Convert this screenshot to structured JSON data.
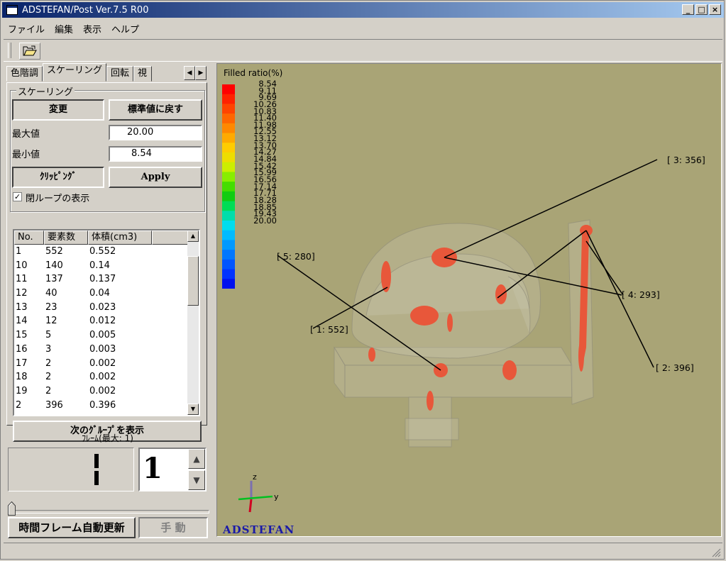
{
  "window": {
    "title": "ADSTEFAN/Post Ver.7.5 R00",
    "btn_min": "_",
    "btn_max": "□",
    "btn_close": "×"
  },
  "menu": [
    "ファイル",
    "編集",
    "表示",
    "ヘルプ"
  ],
  "tabs": [
    "色階調",
    "スケーリング",
    "回転",
    "視"
  ],
  "scaling": {
    "group_title": "スケーリング",
    "change_label": "変更",
    "reset_label": "標準値に戻す",
    "max_label": "最大値",
    "max_value": "20.00",
    "min_label": "最小値",
    "min_value": "8.54",
    "clipping_label": "ｸﾘｯﾋﾟﾝｸﾞ",
    "apply_label": "Apply",
    "closed_loop_label": "閉ループの表示",
    "closed_loop_checked": true
  },
  "table": {
    "headers": [
      "No.",
      "要素数",
      "体積(cm3)",
      ""
    ],
    "rows": [
      [
        "1",
        "552",
        "0.552"
      ],
      [
        "10",
        "140",
        "0.14"
      ],
      [
        "11",
        "137",
        "0.137"
      ],
      [
        "12",
        "40",
        "0.04"
      ],
      [
        "13",
        "23",
        "0.023"
      ],
      [
        "14",
        "12",
        "0.012"
      ],
      [
        "15",
        "5",
        "0.005"
      ],
      [
        "16",
        "3",
        "0.003"
      ],
      [
        "17",
        "2",
        "0.002"
      ],
      [
        "18",
        "2",
        "0.002"
      ],
      [
        "19",
        "2",
        "0.002"
      ],
      [
        "2",
        "396",
        "0.396"
      ]
    ]
  },
  "next_group_label": "次のｸﾞﾙｰﾌﾟを表示",
  "frame": {
    "label": "ﾌﾚｰﾑ(最大: 1)",
    "digital_value": "1",
    "spin_value": "1",
    "slider_position": 0
  },
  "auto_update_label": "時間フレーム自動更新",
  "manual_label": "手 動",
  "viewport": {
    "colorbar_title": "Filled ratio(%)",
    "scale": [
      "8.54",
      "9.11",
      "9.69",
      "10.26",
      "10.83",
      "11.40",
      "11.98",
      "12.55",
      "13.12",
      "13.70",
      "14.27",
      "14.84",
      "15.42",
      "15.99",
      "16.56",
      "17.14",
      "17.71",
      "18.28",
      "18.85",
      "19.43",
      "20.00"
    ],
    "scale_colors": [
      "#ff0000",
      "#ff2200",
      "#ff4400",
      "#ff6600",
      "#ff8800",
      "#ffaa00",
      "#ffcc00",
      "#eedd00",
      "#ccee00",
      "#88ee00",
      "#44dd00",
      "#11cc11",
      "#00dd55",
      "#00ddaa",
      "#00ddee",
      "#00bbff",
      "#0099ff",
      "#0077ff",
      "#0055ff",
      "#0033ff",
      "#0011ee"
    ],
    "callouts": [
      {
        "text": "[ 3:  356]"
      },
      {
        "text": "[ 5:  280]"
      },
      {
        "text": "[ 4:  293]"
      },
      {
        "text": "[ 1:  552]"
      },
      {
        "text": "[ 2:  396]"
      }
    ],
    "axes": {
      "z": "z",
      "y": "y"
    },
    "brand": "ADSTEFAN",
    "background": "#a9a476"
  }
}
